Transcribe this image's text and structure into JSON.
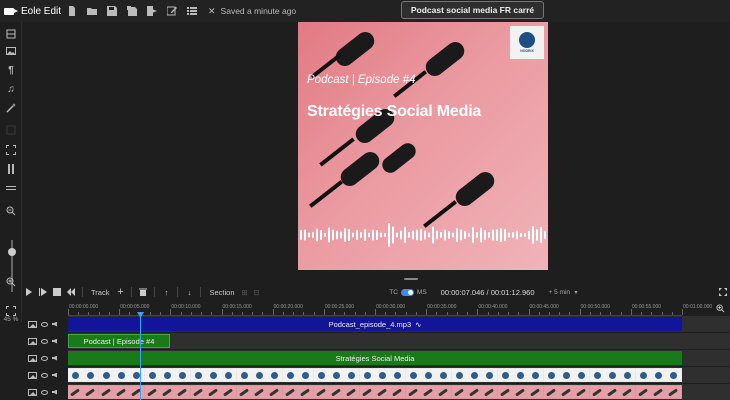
{
  "app": {
    "name": "Eole Edit",
    "saved_status": "Saved a minute ago",
    "project_title": "Podcast social media FR carré"
  },
  "toolbar_icons": [
    "new-file-icon",
    "open-folder-icon",
    "save-icon",
    "save-as-icon",
    "export-icon",
    "edit-icon",
    "list-icon"
  ],
  "left_tools": [
    "layers-icon",
    "image-icon",
    "paragraph-icon",
    "music-icon",
    "magic-wand-icon",
    "blank-icon",
    "fullscreen-icon",
    "split-icon",
    "separator-icon",
    "zoom-out-icon",
    "zoom-in-icon",
    "fit-icon"
  ],
  "zoom_percent": "45 %",
  "canvas": {
    "episode_label": "Podcast | Episode #4",
    "title": "Stratégies Social Media",
    "logo_text": "NODRIX"
  },
  "timeline_toolbar": {
    "track_label": "Track",
    "section_label": "Section",
    "tc_label": "TC",
    "ms_label": "MS",
    "timecode": "00:00:07.046 / 00:01:12.960",
    "zoom_select": "+ 5 min"
  },
  "ruler_labels": [
    "00:00:00.000",
    "00:00:05.000",
    "00:00:10.000",
    "00:00:15.000",
    "00:00:20.000",
    "00:00:25.000",
    "00:00:30.000",
    "00:00:35.000",
    "00:00:40.000",
    "00:00:45.000",
    "00:00:50.000",
    "00:00:55.000",
    "00:01:00.000"
  ],
  "tracks": [
    {
      "clip_label": "Podcast_episode_4.mp3",
      "color": "#12149a"
    },
    {
      "clip_label": "Podcast | Episode #4",
      "color": "#1a7a1a"
    },
    {
      "clip_label": "Stratégies Social Media",
      "color": "#1a7a1a"
    },
    {
      "clip_label": "",
      "color": "#e8e8ea"
    },
    {
      "clip_label": "",
      "color": "#d89a9f"
    }
  ],
  "colors": {
    "accent": "#3aa3ff",
    "audio_clip": "#12149a",
    "text_clip": "#1a7a1a"
  }
}
